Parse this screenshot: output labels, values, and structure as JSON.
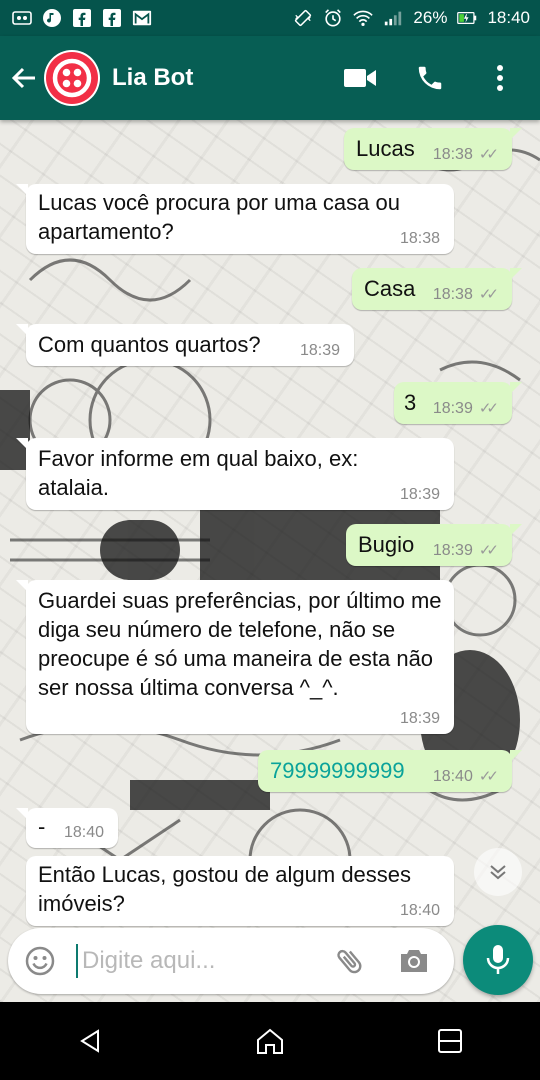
{
  "status_bar": {
    "battery": "26%",
    "time": "18:40",
    "icons": [
      "voicemail-icon",
      "music-icon",
      "facebook-icon",
      "facebook-icon",
      "gmail-icon",
      "vibrate-icon",
      "alarm-icon",
      "wifi-icon",
      "signal-icon",
      "battery-icon"
    ]
  },
  "header": {
    "title": "Lia Bot",
    "icons": [
      "back-arrow-icon",
      "twilio-avatar",
      "video-call-icon",
      "voice-call-icon",
      "more-vert-icon"
    ]
  },
  "messages": [
    {
      "dir": "out",
      "text": "Lucas",
      "time": "18:38",
      "ticks": "✓✓"
    },
    {
      "dir": "in",
      "text": "Lucas você procura por uma casa ou apartamento?",
      "time": "18:38"
    },
    {
      "dir": "out",
      "text": "Casa",
      "time": "18:38",
      "ticks": "✓✓"
    },
    {
      "dir": "in",
      "text": "Com quantos quartos?",
      "time": "18:39"
    },
    {
      "dir": "out",
      "text": "3",
      "time": "18:39",
      "ticks": "✓✓"
    },
    {
      "dir": "in",
      "text": "Favor informe em qual baixo, ex: atalaia.",
      "time": "18:39"
    },
    {
      "dir": "out",
      "text": "Bugio",
      "time": "18:39",
      "ticks": "✓✓"
    },
    {
      "dir": "in",
      "text": "Guardei suas preferências, por último me diga seu número de telefone, não se preocupe é só uma maneira de esta não ser nossa última conversa ^_^.",
      "time": "18:39"
    },
    {
      "dir": "out",
      "text": "79999999999",
      "time": "18:40",
      "ticks": "✓✓"
    },
    {
      "dir": "in",
      "text": "-",
      "time": "18:40"
    },
    {
      "dir": "in",
      "text": "Então Lucas, gostou de algum desses imóveis?",
      "time": "18:40"
    }
  ],
  "input": {
    "placeholder": "Digite aqui..."
  },
  "colors": {
    "header": "#075e54",
    "status_bar": "#05544c",
    "outgoing_bubble": "#dcf8c6",
    "incoming_bubble": "#ffffff",
    "accent": "#0c8b7a"
  }
}
